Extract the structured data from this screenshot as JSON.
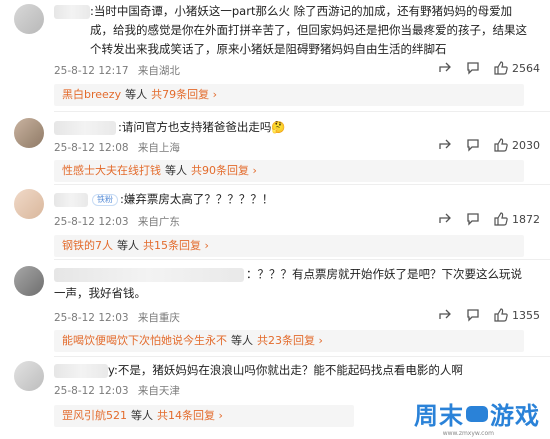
{
  "comments": [
    {
      "text": ":当时中国奇谭，小猪妖这一part那么火 除了西游记的加成，还有野猪妈妈的母爱加成，给我的感觉是你在外面打拼辛苦了，但回家妈妈还是把你当最疼爱的孩子，结果这个转发出来我成笑话了，原来小猪妖是阻碍野猪妈妈自由生活的绊脚石",
      "date": "25-8-12 12:17",
      "location": "来自湖北",
      "share_count": "",
      "comment_count": "",
      "like_count": "2564",
      "reply": {
        "name": "黑白breezy",
        "mid": "等人",
        "count": "共79条回复"
      }
    },
    {
      "text": ":请问官方也支持猪爸爸出走吗🤔",
      "date": "25-8-12 12:08",
      "location": "来自上海",
      "like_count": "2030",
      "reply": {
        "name": "性感士大夫在线打钱",
        "mid": "等人",
        "count": "共90条回复"
      }
    },
    {
      "badge": "铁粉",
      "text": ":嫌弃票房太高了？？？？？！",
      "date": "25-8-12 12:03",
      "location": "来自广东",
      "like_count": "1872",
      "reply": {
        "name": "钢铁的7人",
        "mid": "等人",
        "count": "共15条回复"
      }
    },
    {
      "text": "：？？？有点票房就开始作妖了是吧？下次要这么玩说一声，我好省钱。",
      "date": "25-8-12 12:03",
      "location": "来自重庆",
      "like_count": "1355",
      "reply": {
        "name": "能喝饮便喝饮下次怕她说今生永不",
        "mid": "等人",
        "count": "共23条回复"
      }
    },
    {
      "text": "y:不是，猪妖妈妈在浪浪山吗你就出走？能不能起码找点看电影的人啊",
      "date": "25-8-12 12:03",
      "location": "来自天津",
      "like_count": "",
      "reply": {
        "name": "罡风引航521",
        "mid": "等人",
        "count": "共14条回复"
      }
    }
  ],
  "watermark": {
    "text1": "周末",
    "text2": "游戏",
    "url": "www.zmxyw.com"
  }
}
